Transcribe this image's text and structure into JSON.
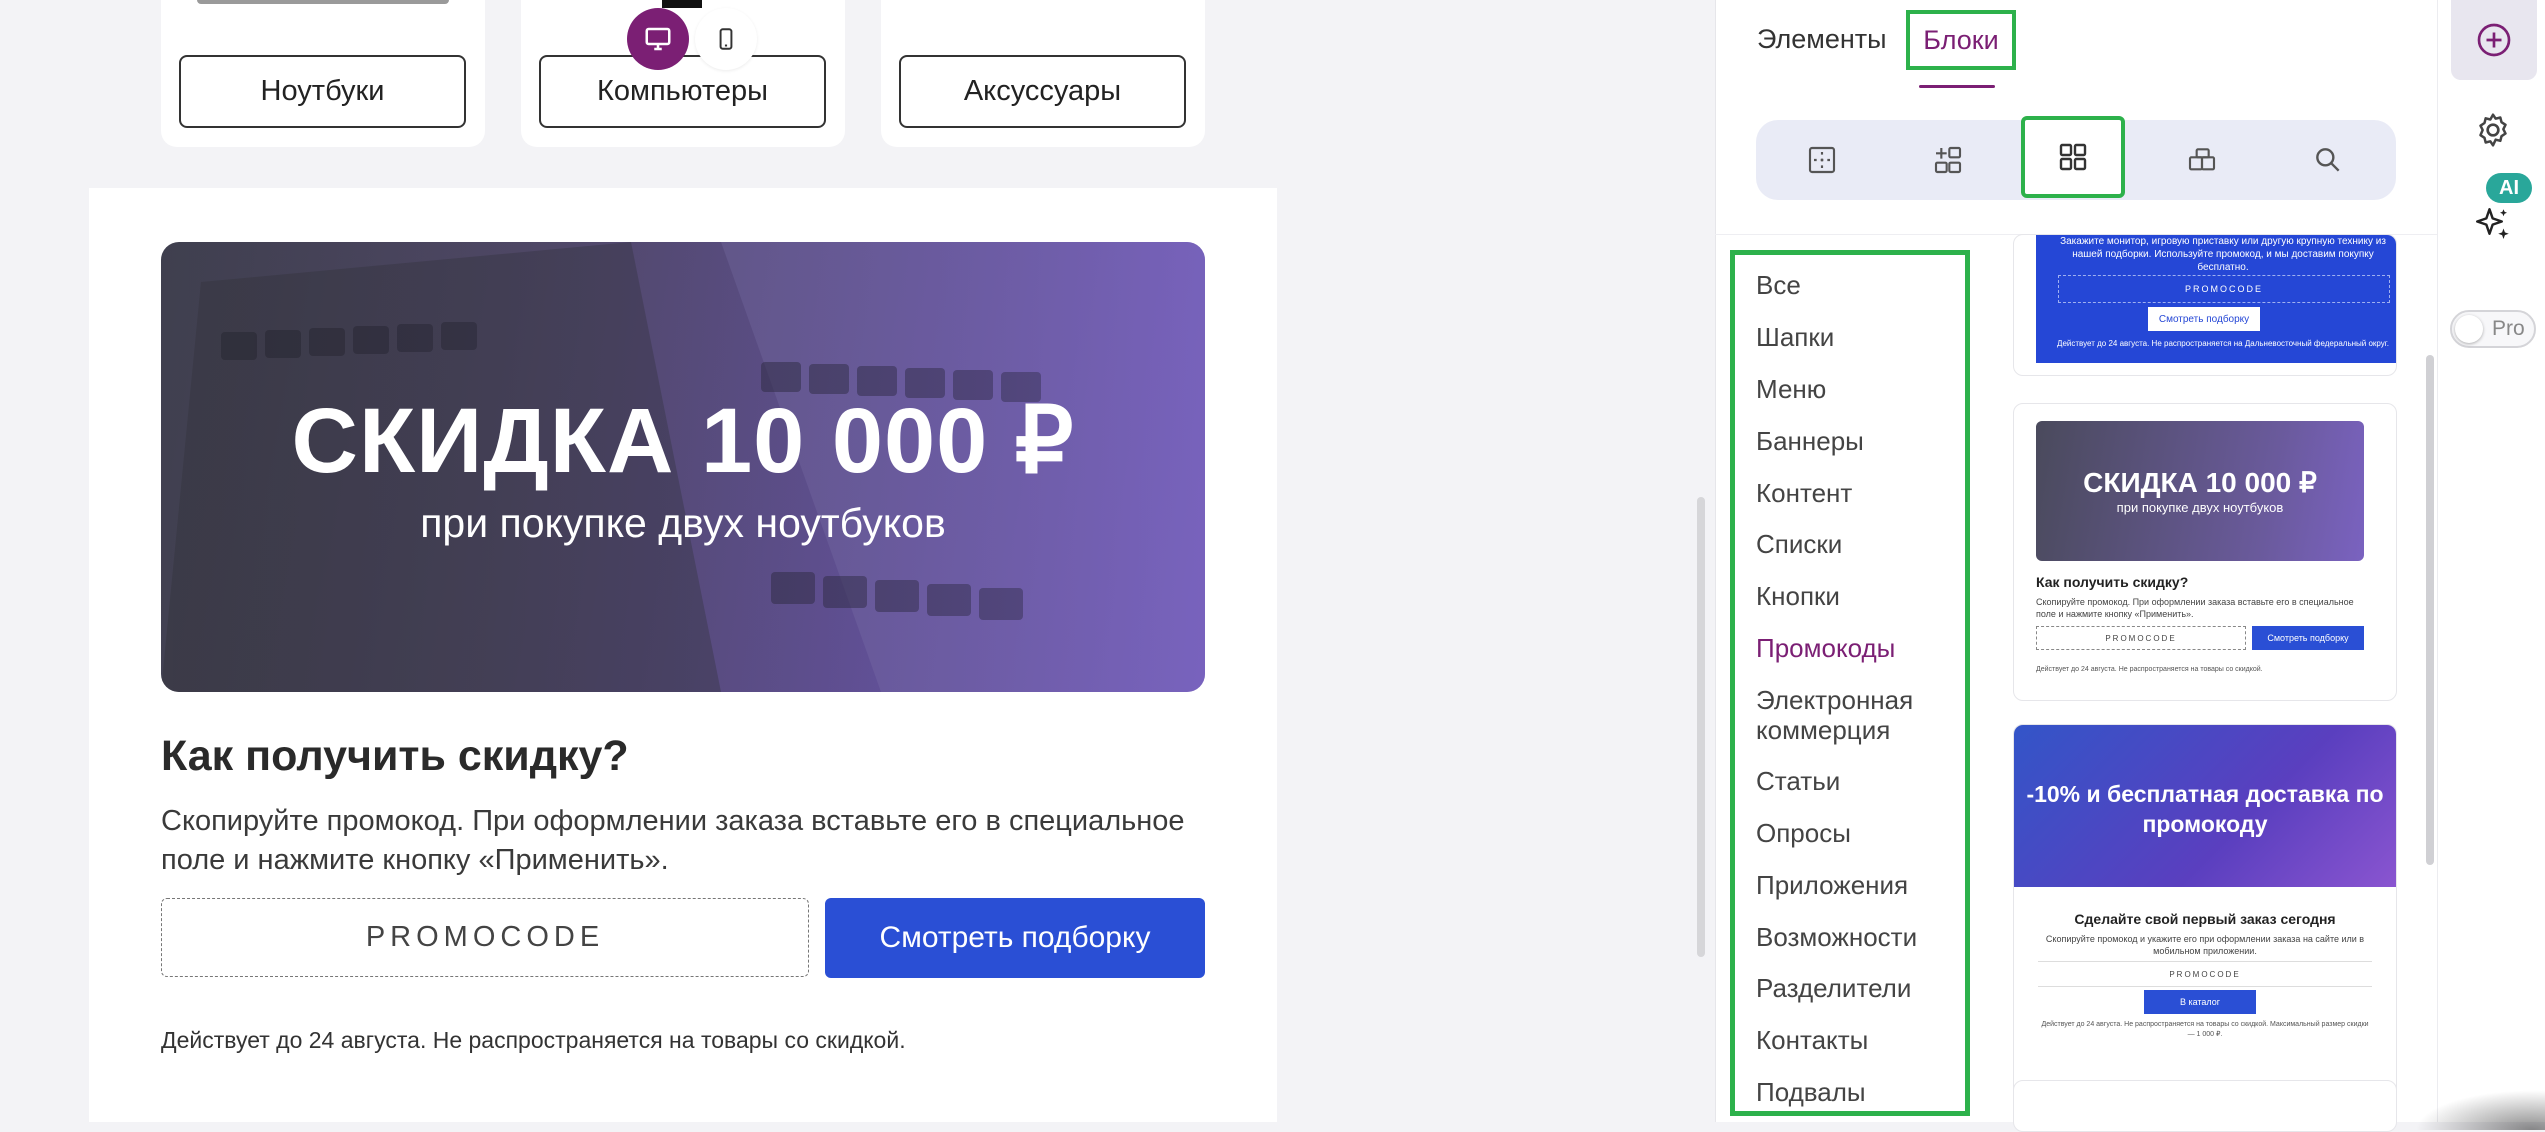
{
  "canvas": {
    "category_buttons": [
      "Ноутбуки",
      "Компьютеры",
      "Аксуссуары"
    ],
    "device_toggle": {
      "desktop_icon": "desktop-icon",
      "mobile_icon": "mobile-icon"
    },
    "banner": {
      "title": "СКИДКА 10 000 ₽",
      "subtitle": "при покупке двух ноутбуков"
    },
    "how_title": "Как получить скидку?",
    "how_text": "Скопируйте промокод. При оформлении заказа вставьте его в специальное поле и нажмите кнопку «Применить».",
    "promo_code": "PROMOCODE",
    "promo_button": "Смотреть подборку",
    "disclaimer": "Действует до 24 августа. Не распространяется на товары со скидкой."
  },
  "panel": {
    "tabs": [
      {
        "label": "Элементы",
        "active": false
      },
      {
        "label": "Блоки",
        "active": true
      }
    ],
    "toolbar": [
      "layout-grid-icon",
      "add-block-icon",
      "blocks-grid-icon",
      "saved-blocks-icon",
      "search-icon"
    ],
    "categories": [
      {
        "label": "Все"
      },
      {
        "label": "Шапки"
      },
      {
        "label": "Меню"
      },
      {
        "label": "Баннеры"
      },
      {
        "label": "Контент"
      },
      {
        "label": "Списки"
      },
      {
        "label": "Кнопки"
      },
      {
        "label": "Промокоды",
        "active": true
      },
      {
        "label": "Электронная коммерция"
      },
      {
        "label": "Статьи"
      },
      {
        "label": "Опросы"
      },
      {
        "label": "Приложения"
      },
      {
        "label": "Возможности"
      },
      {
        "label": "Разделители"
      },
      {
        "label": "Контакты"
      },
      {
        "label": "Подвалы"
      }
    ],
    "thumbnails": {
      "t1": {
        "text": "Закажите монитор, игровую приставку или другую крупную технику из нашей подборки. Используйте промокод, и мы доставим покупку бесплатно.",
        "code": "PROMOCODE",
        "button": "Смотреть подборку",
        "note": "Действует до 24 августа. Не распространяется на Дальневосточный федеральный округ."
      },
      "t2": {
        "title": "СКИДКА 10 000 ₽",
        "subtitle": "при покупке двух ноутбуков",
        "heading": "Как получить скидку?",
        "text": "Скопируйте промокод. При оформлении заказа вставьте его в специальное поле и нажмите кнопку «Применить».",
        "code": "PROMOCODE",
        "button": "Смотреть подборку",
        "note": "Действует до 24 августа. Не распространяется на товары со скидкой."
      },
      "t3": {
        "title": "-10% и бесплатная доставка по промокоду",
        "heading": "Сделайте свой первый заказ сегодня",
        "text": "Скопируйте промокод и укажите его при оформлении заказа на сайте или в мобильном приложении.",
        "code": "PROMOCODE",
        "button": "В каталог",
        "note": "Действует до 24 августа. Не распространяется на товары со скидкой. Максимальный размер скидки — 1 000 ₽."
      }
    }
  },
  "rail": {
    "ai_badge": "AI",
    "pro_label": "Pro",
    "pro_enabled": false
  }
}
